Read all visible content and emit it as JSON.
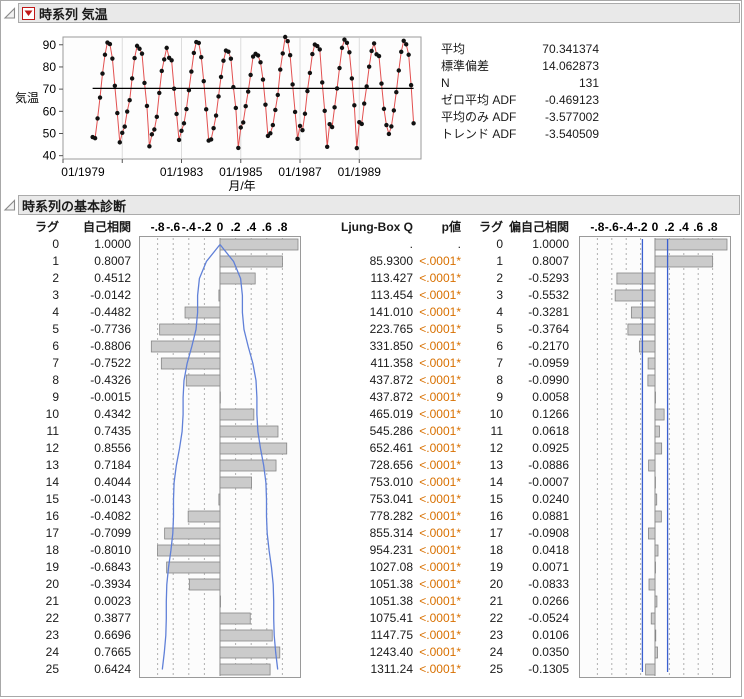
{
  "colors": {
    "series_line": "#e25050",
    "mean_line": "#000000",
    "point": "#111111",
    "bar_fill": "#cbcbcb",
    "bar_stroke": "#868686",
    "conf_curve": "#6080d8",
    "conf_line": "#3a5fd0",
    "p_value": "#d87000",
    "header_bg": "#e9e9e9",
    "grid": "#b0b0b0"
  },
  "panel1": {
    "title": "時系列 気温",
    "icons": [
      "disclosure-triangle-icon",
      "red-triangle-menu-icon"
    ],
    "stats": [
      {
        "label": "平均",
        "value": "70.341374"
      },
      {
        "label": "標準偏差",
        "value": "14.062873"
      },
      {
        "label": "N",
        "value": "131"
      },
      {
        "label": "ゼロ平均 ADF",
        "value": "-0.469123"
      },
      {
        "label": "平均のみ ADF",
        "value": "-3.577002"
      },
      {
        "label": "トレンド ADF",
        "value": "-3.540509"
      }
    ]
  },
  "panel2": {
    "title": "時系列の基本診断",
    "headers": {
      "lag": "ラグ",
      "acf": "自己相関",
      "scale": "-.8-.6-.4-.20 .2 .4 .6 .8",
      "ljung": "Ljung-Box Q",
      "p": "p値",
      "lag2": "ラグ",
      "pacf": "偏自己相関",
      "scale2": "-.8-.6-.4-.20 .2 .4 .6 .8"
    },
    "scale_labels": [
      "-.8",
      "-.6",
      "-.4",
      "-.2",
      "0",
      ".2",
      ".4",
      ".6",
      ".8"
    ]
  },
  "diagnostics": {
    "lags": [
      0,
      1,
      2,
      3,
      4,
      5,
      6,
      7,
      8,
      9,
      10,
      11,
      12,
      13,
      14,
      15,
      16,
      17,
      18,
      19,
      20,
      21,
      22,
      23,
      24,
      25
    ],
    "acf_text": [
      "1.0000",
      "0.8007",
      "0.4512",
      "-0.0142",
      "-0.4482",
      "-0.7736",
      "-0.8806",
      "-0.7522",
      "-0.4326",
      "-0.0015",
      "0.4342",
      "0.7435",
      "0.8556",
      "0.7184",
      "0.4044",
      "-0.0143",
      "-0.4082",
      "-0.7099",
      "-0.8010",
      "-0.6843",
      "-0.3934",
      "0.0023",
      "0.3877",
      "0.6696",
      "0.7665",
      "0.6424"
    ],
    "ljung_q_text": [
      ".",
      "85.9300",
      "113.427",
      "113.454",
      "141.010",
      "223.765",
      "331.850",
      "411.358",
      "437.872",
      "437.872",
      "465.019",
      "545.286",
      "652.461",
      "728.656",
      "753.010",
      "753.041",
      "778.282",
      "855.314",
      "954.231",
      "1027.08",
      "1051.38",
      "1051.38",
      "1075.41",
      "1147.75",
      "1243.40",
      "1311.24"
    ],
    "p_text": [
      ".",
      "<.0001*",
      "<.0001*",
      "<.0001*",
      "<.0001*",
      "<.0001*",
      "<.0001*",
      "<.0001*",
      "<.0001*",
      "<.0001*",
      "<.0001*",
      "<.0001*",
      "<.0001*",
      "<.0001*",
      "<.0001*",
      "<.0001*",
      "<.0001*",
      "<.0001*",
      "<.0001*",
      "<.0001*",
      "<.0001*",
      "<.0001*",
      "<.0001*",
      "<.0001*",
      "<.0001*",
      "<.0001*"
    ],
    "pacf_text": [
      "1.0000",
      "0.8007",
      "-0.5293",
      "-0.5532",
      "-0.3281",
      "-0.3764",
      "-0.2170",
      "-0.0959",
      "-0.0990",
      "0.0058",
      "0.1266",
      "0.0618",
      "0.0925",
      "-0.0886",
      "-0.0007",
      "0.0240",
      "0.0881",
      "-0.0908",
      "0.0418",
      "0.0071",
      "-0.0833",
      "0.0266",
      "-0.0524",
      "0.0106",
      "0.0350",
      "-0.1305"
    ]
  },
  "chart_data": [
    {
      "type": "line",
      "title": "時系列 気温 (time series plot)",
      "xlabel": "月/年",
      "ylabel": "気温",
      "ylim": [
        40,
        90
      ],
      "yticks": [
        40,
        50,
        60,
        70,
        80,
        90
      ],
      "xticks": [
        {
          "m": 0,
          "label": "01/1979"
        },
        {
          "m": 24,
          "label": ""
        },
        {
          "m": 48,
          "label": "01/1983"
        },
        {
          "m": 72,
          "label": "01/1985"
        },
        {
          "m": 96,
          "label": "01/1987"
        },
        {
          "m": 120,
          "label": "01/1989"
        }
      ],
      "x_axis_months": 145,
      "mean": 70.341374,
      "n": 131,
      "start_month_index": 12,
      "values": [
        48.4,
        47.9,
        56.8,
        66.2,
        77.0,
        85.5,
        91.0,
        90.3,
        83.8,
        71.5,
        59.2,
        46.0,
        50.3,
        53.1,
        59.9,
        65.0,
        74.8,
        84.0,
        89.5,
        88.2,
        86.0,
        72.8,
        62.4,
        44.2,
        49.6,
        51.8,
        57.5,
        68.3,
        78.2,
        83.4,
        88.6,
        84.1,
        83.0,
        70.2,
        58.8,
        47.1,
        51.2,
        54.6,
        61.0,
        69.5,
        77.9,
        86.3,
        91.2,
        90.8,
        84.4,
        73.6,
        60.9,
        46.8,
        47.3,
        52.4,
        58.1,
        66.7,
        75.5,
        82.8,
        87.4,
        86.9,
        83.7,
        70.9,
        61.5,
        43.5,
        52.7,
        55.0,
        62.3,
        68.9,
        76.4,
        84.7,
        85.9,
        85.2,
        82.1,
        74.3,
        63.0,
        48.9,
        50.1,
        53.8,
        60.6,
        67.4,
        78.8,
        86.1,
        93.5,
        91.6,
        85.3,
        72.1,
        59.7,
        47.6,
        53.4,
        51.5,
        58.9,
        69.1,
        77.3,
        85.8,
        90.1,
        89.4,
        87.9,
        73.0,
        60.2,
        44.0,
        54.2,
        52.9,
        61.8,
        70.3,
        79.5,
        88.6,
        92.3,
        90.9,
        86.6,
        74.8,
        62.7,
        43.4,
        55.1,
        54.3,
        63.5,
        71.2,
        80.1,
        87.2,
        90.6,
        85.7,
        84.9,
        72.5,
        61.1,
        53.8,
        49.8,
        53.2,
        60.4,
        68.6,
        78.4,
        86.8,
        91.8,
        90.2,
        85.5,
        71.8,
        54.6
      ]
    },
    {
      "type": "bar",
      "title": "自己相関 (autocorrelation)",
      "orientation": "horizontal",
      "categories": [
        0,
        1,
        2,
        3,
        4,
        5,
        6,
        7,
        8,
        9,
        10,
        11,
        12,
        13,
        14,
        15,
        16,
        17,
        18,
        19,
        20,
        21,
        22,
        23,
        24,
        25
      ],
      "values": [
        1.0,
        0.8007,
        0.4512,
        -0.0142,
        -0.4482,
        -0.7736,
        -0.8806,
        -0.7522,
        -0.4326,
        -0.0015,
        0.4342,
        0.7435,
        0.8556,
        0.7184,
        0.4044,
        -0.0143,
        -0.4082,
        -0.7099,
        -0.801,
        -0.6843,
        -0.3934,
        0.0023,
        0.3877,
        0.6696,
        0.7665,
        0.6424
      ],
      "xlim": [
        -1,
        1
      ],
      "grid": "dashed at ±.2/.4/.6/.8",
      "confidence": "blue ±2SE funnel curves",
      "n": 131
    },
    {
      "type": "bar",
      "title": "偏自己相関 (partial autocorrelation)",
      "orientation": "horizontal",
      "categories": [
        0,
        1,
        2,
        3,
        4,
        5,
        6,
        7,
        8,
        9,
        10,
        11,
        12,
        13,
        14,
        15,
        16,
        17,
        18,
        19,
        20,
        21,
        22,
        23,
        24,
        25
      ],
      "values": [
        1.0,
        0.8007,
        -0.5293,
        -0.5532,
        -0.3281,
        -0.3764,
        -0.217,
        -0.0959,
        -0.099,
        0.0058,
        0.1266,
        0.0618,
        0.0925,
        -0.0886,
        -0.0007,
        0.024,
        0.0881,
        -0.0908,
        0.0418,
        0.0071,
        -0.0833,
        0.0266,
        -0.0524,
        0.0106,
        0.035,
        -0.1305
      ],
      "xlim": [
        -1,
        1
      ],
      "grid": "dashed at ±.2/.4/.6/.8",
      "confidence": "blue vertical lines at ±0.175",
      "n": 131
    }
  ]
}
